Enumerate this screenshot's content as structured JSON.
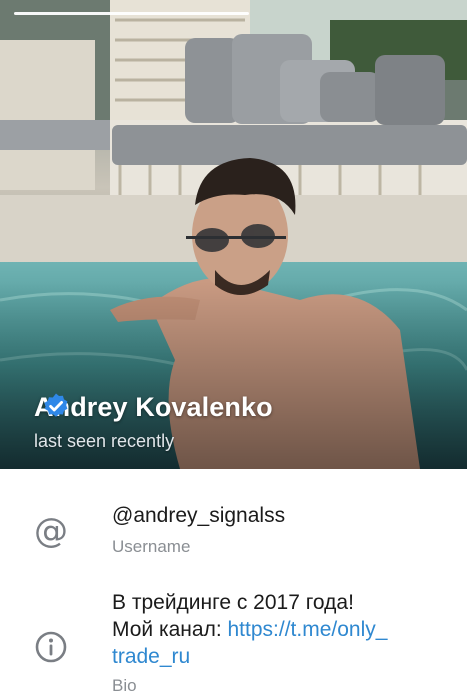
{
  "profile": {
    "name": "Andrey Kovalenko",
    "status": "last seen recently",
    "verified_color": "#2f88e8"
  },
  "username": {
    "value": "@andrey_signalss",
    "label": "Username",
    "icon": "at-icon"
  },
  "bio": {
    "line1": "В трейдинге с 2017 года!",
    "prefix": "Мой канал: ",
    "link_part1": "https://t.me/only_",
    "link_part2": "trade_ru",
    "label": "Bio",
    "icon": "info-icon"
  },
  "colors": {
    "accent": "#2f88d0",
    "secondary_text": "#8a8e93",
    "icon_gray": "#7a7e84"
  }
}
